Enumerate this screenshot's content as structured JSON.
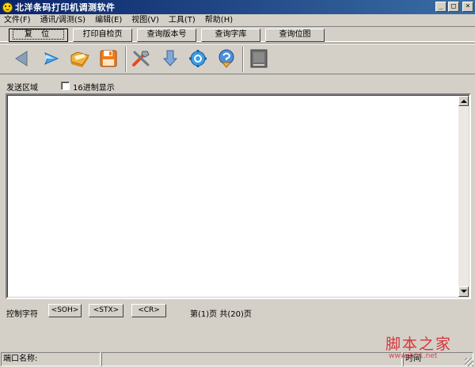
{
  "window": {
    "title": "北洋条码打印机调测软件",
    "min": "_",
    "max": "□",
    "close": "×"
  },
  "menu": [
    "文件(F)",
    "通讯/调测(S)",
    "编辑(E)",
    "视图(V)",
    "工具(T)",
    "帮助(H)"
  ],
  "commands": {
    "reset": "复 位",
    "self_test": "打印自检页",
    "query_version": "查询版本号",
    "query_font": "查询字库",
    "query_bitmap": "查询位图"
  },
  "toolbar_icons": [
    "back-arrow-icon",
    "send-arrow-icon",
    "open-folder-icon",
    "save-disk-icon",
    "tools-icon",
    "download-icon",
    "settings-gear-icon",
    "help-icon",
    "printer-icon"
  ],
  "send_area": {
    "label": "发送区域",
    "hex_label": "16进制显示",
    "hex_checked": false,
    "text": ""
  },
  "control": {
    "label": "控制字符",
    "soh": "<SOH>",
    "stx": "<STX>",
    "cr": "<CR>",
    "page_info": "第(1)页 共(20)页"
  },
  "status": {
    "port_name": "端口名称:",
    "time": "时间"
  },
  "watermark": {
    "brand": "脚本之家",
    "url": "www.jb51.net"
  },
  "colors": {
    "title_start": "#0a246a",
    "title_end": "#3a6ea5",
    "face": "#d4d0c8",
    "watermark": "#d9232a"
  }
}
